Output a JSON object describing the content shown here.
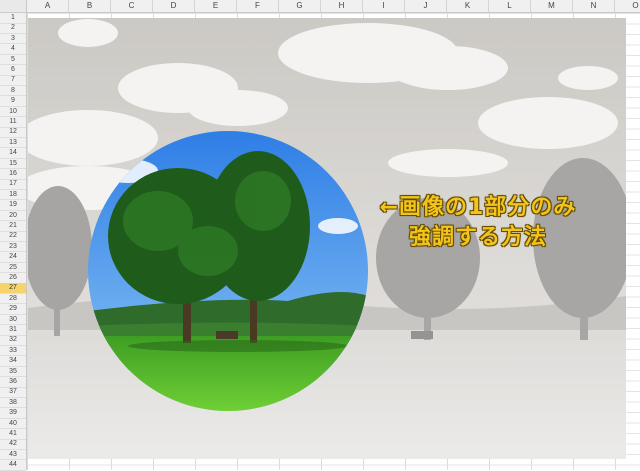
{
  "spreadsheet": {
    "columns": [
      "A",
      "B",
      "C",
      "D",
      "E",
      "F",
      "G",
      "H",
      "I",
      "J",
      "K",
      "L",
      "M",
      "N",
      "O"
    ],
    "rows": [
      "1",
      "2",
      "3",
      "4",
      "5",
      "6",
      "7",
      "8",
      "9",
      "10",
      "11",
      "12",
      "13",
      "14",
      "15",
      "16",
      "17",
      "18",
      "19",
      "20",
      "21",
      "22",
      "23",
      "24",
      "25",
      "26",
      "27",
      "28",
      "29",
      "30",
      "31",
      "32",
      "33",
      "34",
      "35",
      "36",
      "37",
      "38",
      "39",
      "40",
      "41",
      "42",
      "43",
      "44"
    ],
    "active_row": "27"
  },
  "caption": {
    "line1": "←画像の1部分のみ",
    "line2": "強調する方法"
  },
  "colors": {
    "caption_text": "#f3c419",
    "active_row_highlight": "#f5d46a",
    "sky": "#3b8ee6",
    "grass": "#59b62b"
  }
}
